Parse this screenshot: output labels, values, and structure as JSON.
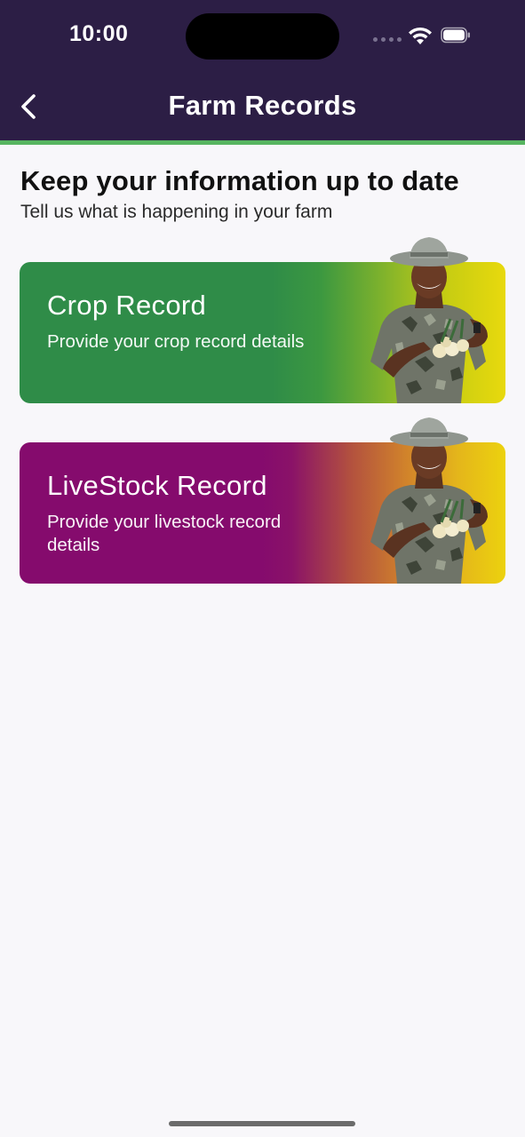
{
  "status_bar": {
    "time": "10:00"
  },
  "nav": {
    "title": "Farm Records",
    "back_icon": "chevron-left-icon"
  },
  "intro": {
    "headline": "Keep your information up to date",
    "subheadline": "Tell us what is happening in your farm"
  },
  "records": [
    {
      "title": "Crop Record",
      "description": "Provide your crop record details",
      "gradient_start": "#2f8c48",
      "gradient_end": "#e8d90d"
    },
    {
      "title": "LiveStock Record",
      "description": "Provide your livestock record details",
      "gradient_start": "#850b6d",
      "gradient_end": "#ecd20e"
    }
  ],
  "colors": {
    "header_bg": "#2c1e45",
    "accent_line": "#57b560",
    "page_bg": "#f8f7fa"
  }
}
